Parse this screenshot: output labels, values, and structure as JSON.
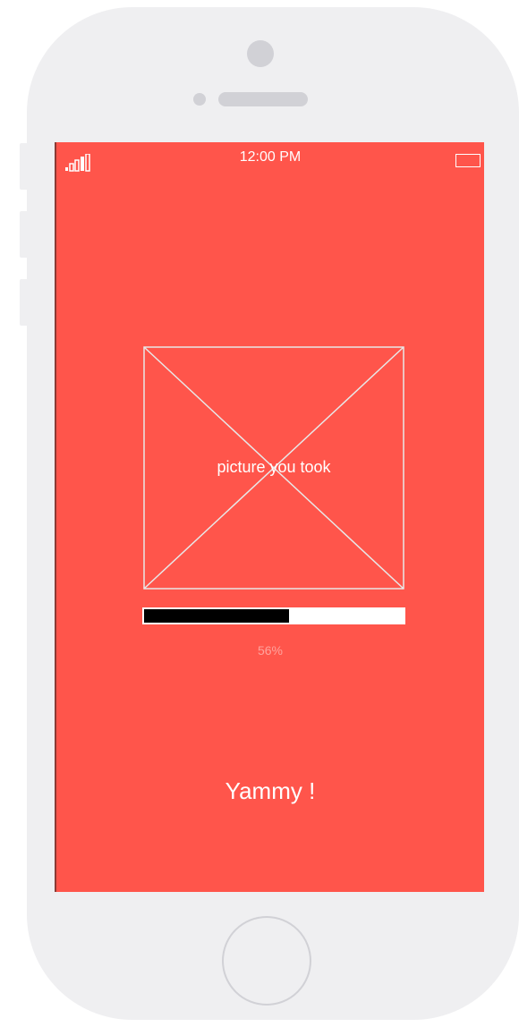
{
  "status_bar": {
    "time": "12:00 PM",
    "signal_icon": "signal-bars-icon",
    "battery_icon": "battery-icon"
  },
  "photo": {
    "label": "picture you took",
    "icon": "image-placeholder-icon"
  },
  "progress": {
    "value": 0.56,
    "text": "56%"
  },
  "message": "Yammy !",
  "colors": {
    "screen_background": "#ff554b",
    "device_body": "#efeff1",
    "progress_fill": "#000000",
    "progress_track": "#ffffff",
    "progress_text": "#ffa39d"
  }
}
